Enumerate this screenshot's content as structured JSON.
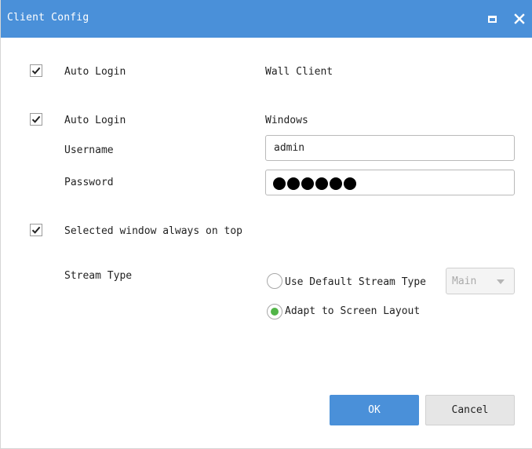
{
  "window": {
    "title": "Client Config",
    "maximize_icon": "maximize-icon",
    "close_icon": "close-icon",
    "titlebar_color": "#4a90d9"
  },
  "wall_client": {
    "auto_login_checked": true,
    "auto_login_label": "Auto Login",
    "section_label": "Wall Client"
  },
  "windows": {
    "auto_login_checked": true,
    "auto_login_label": "Auto Login",
    "section_label": "Windows",
    "username_label": "Username",
    "username_value": "admin",
    "password_label": "Password",
    "password_masked_length": 6
  },
  "always_on_top": {
    "checked": true,
    "label": "Selected window always on top"
  },
  "stream": {
    "label": "Stream Type",
    "options": [
      {
        "label": "Use Default Stream Type",
        "selected": false
      },
      {
        "label": "Adapt to Screen Layout",
        "selected": true
      }
    ],
    "default_stream_select": {
      "value": "Main",
      "disabled": true
    },
    "selected_color": "#52b548"
  },
  "buttons": {
    "ok": "OK",
    "cancel": "Cancel",
    "ok_color": "#4a90d9"
  }
}
